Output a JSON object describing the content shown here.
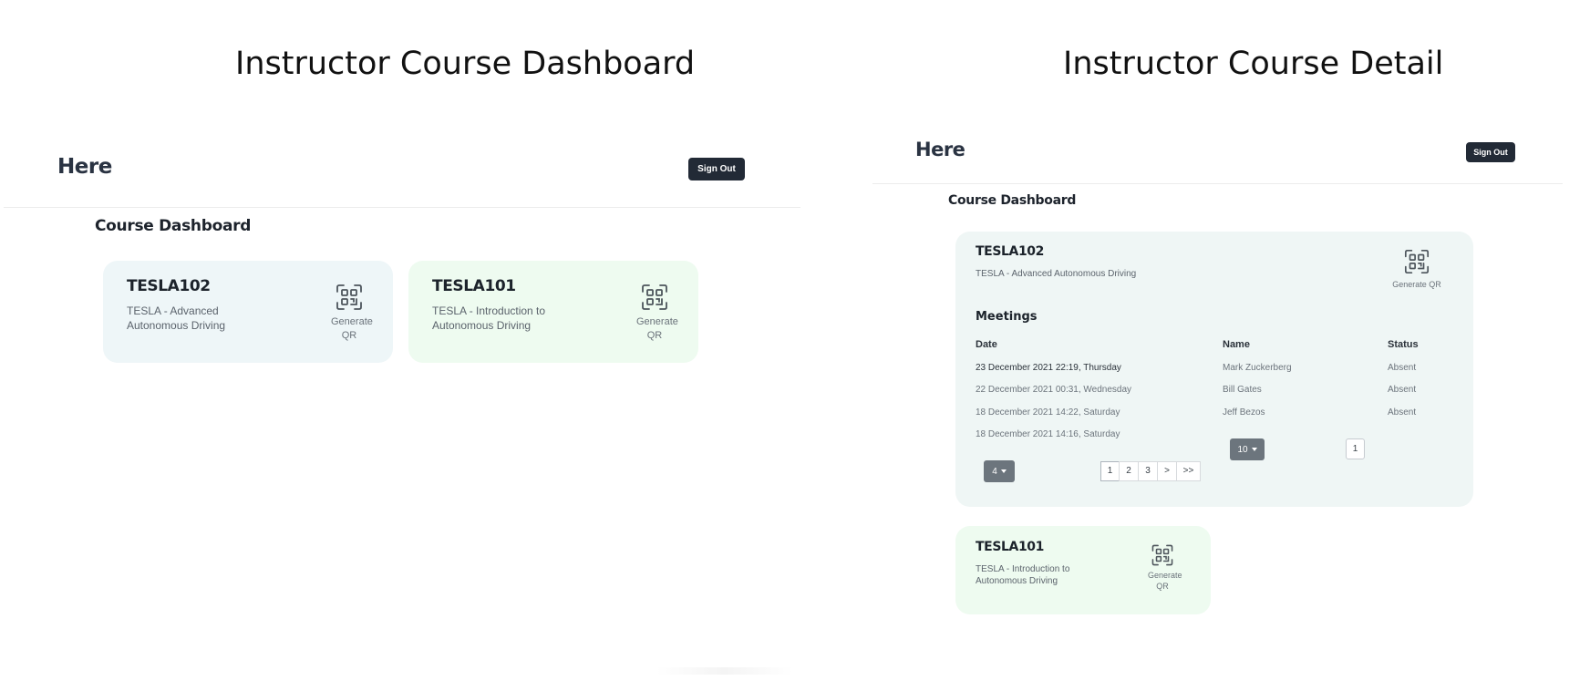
{
  "slides": {
    "left_title": "Instructor Course Dashboard",
    "right_title": "Instructor Course Detail"
  },
  "dashboard": {
    "brand": "Here",
    "sign_out": "Sign Out",
    "section_title": "Course Dashboard",
    "courses": [
      {
        "code": "TESLA102",
        "name": "TESLA - Advanced Autonomous Driving",
        "qr_label": "Generate QR",
        "color": "#eef6f8"
      },
      {
        "code": "TESLA101",
        "name": "TESLA - Introduction to Autonomous Driving",
        "qr_label": "Generate QR",
        "color": "#eefbf0"
      }
    ]
  },
  "detail": {
    "brand": "Here",
    "sign_out": "Sign Out",
    "section_title": "Course Dashboard",
    "expanded_course": {
      "code": "TESLA102",
      "name": "TESLA - Advanced Autonomous Driving",
      "qr_label": "Generate QR",
      "meetings_title": "Meetings",
      "date_header": "Date",
      "dates": [
        "23 December 2021 22:19, Thursday",
        "22 December 2021 00:31, Wednesday",
        "18 December 2021 14:22, Saturday",
        "18 December 2021 14:16, Saturday"
      ],
      "dates_page_size": "4",
      "dates_pages": [
        "1",
        "2",
        "3",
        ">",
        ">>"
      ],
      "attendance_headers": {
        "name": "Name",
        "status": "Status"
      },
      "attendance": [
        {
          "name": "Mark Zuckerberg",
          "status": "Absent"
        },
        {
          "name": "Bill Gates",
          "status": "Absent"
        },
        {
          "name": "Jeff Bezos",
          "status": "Absent"
        }
      ],
      "attendance_page_size": "10",
      "attendance_page": "1"
    },
    "other_course": {
      "code": "TESLA101",
      "name": "TESLA - Introduction to Autonomous Driving",
      "qr_label": "Generate QR"
    }
  }
}
